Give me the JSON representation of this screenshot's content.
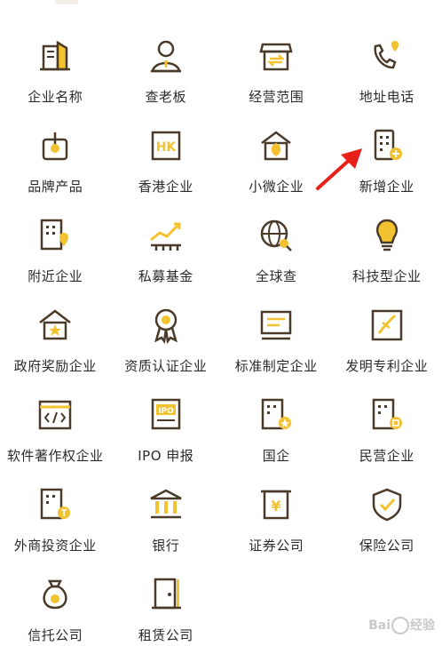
{
  "colors": {
    "icon_dark": "#4a3a2a",
    "icon_accent": "#f2c230",
    "label": "#2b2b2b",
    "arrow": "#e8201a",
    "watermark": "#c9c9c9"
  },
  "items": [
    {
      "label": "企业名称",
      "icon": "building-doc-icon"
    },
    {
      "label": "查老板",
      "icon": "person-icon"
    },
    {
      "label": "经营范围",
      "icon": "storefront-icon"
    },
    {
      "label": "地址电话",
      "icon": "phone-pin-icon"
    },
    {
      "label": "品牌产品",
      "icon": "brand-box-icon"
    },
    {
      "label": "香港企业",
      "icon": "hk-badge-icon"
    },
    {
      "label": "小微企业",
      "icon": "house-leaf-icon"
    },
    {
      "label": "新增企业",
      "icon": "building-plus-icon"
    },
    {
      "label": "附近企业",
      "icon": "building-pin-icon"
    },
    {
      "label": "私募基金",
      "icon": "growth-chart-icon"
    },
    {
      "label": "全球查",
      "icon": "globe-search-icon"
    },
    {
      "label": "科技型企业",
      "icon": "lightbulb-icon"
    },
    {
      "label": "政府奖励企业",
      "icon": "house-star-icon"
    },
    {
      "label": "资质认证企业",
      "icon": "award-ribbon-icon"
    },
    {
      "label": "标准制定企业",
      "icon": "monitor-doc-icon"
    },
    {
      "label": "发明专利企业",
      "icon": "patent-certificate-icon"
    },
    {
      "label": "软件著作权企业",
      "icon": "code-window-icon"
    },
    {
      "label": "IPO 申报",
      "icon": "ipo-document-icon"
    },
    {
      "label": "国企",
      "icon": "building-star-icon"
    },
    {
      "label": "民营企业",
      "icon": "building-private-icon"
    },
    {
      "label": "外商投资企业",
      "icon": "building-foreign-icon"
    },
    {
      "label": "银行",
      "icon": "bank-icon"
    },
    {
      "label": "证券公司",
      "icon": "securities-scroll-icon"
    },
    {
      "label": "保险公司",
      "icon": "shield-check-icon"
    },
    {
      "label": "信托公司",
      "icon": "money-bag-icon"
    },
    {
      "label": "租赁公司",
      "icon": "door-icon"
    }
  ],
  "annotation": {
    "arrow_target": "新增企业"
  },
  "watermark": {
    "brand": "Bai",
    "suffix": "经验"
  }
}
